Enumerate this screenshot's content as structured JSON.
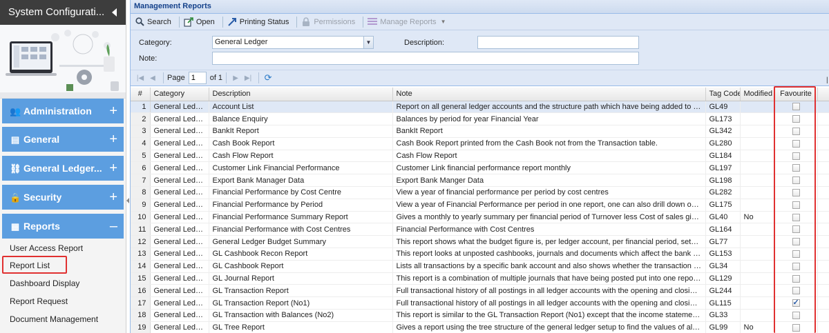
{
  "sidebar": {
    "title": "System Configurati...",
    "groups": [
      {
        "label": "Administration",
        "icon": "users-icon",
        "toggle": "+"
      },
      {
        "label": "General",
        "icon": "file-icon",
        "toggle": "+"
      },
      {
        "label": "General Ledger...",
        "icon": "link-icon",
        "toggle": "+"
      },
      {
        "label": "Security",
        "icon": "lock-icon",
        "toggle": "+"
      },
      {
        "label": "Reports",
        "icon": "report-icon",
        "toggle": "–"
      }
    ],
    "report_items": [
      "User Access Report",
      "Report List",
      "Dashboard Display",
      "Report Request",
      "Document Management"
    ]
  },
  "panel": {
    "title": "Management Reports"
  },
  "toolbar": {
    "search": "Search",
    "open": "Open",
    "printing_status": "Printing Status",
    "permissions": "Permissions",
    "manage_reports": "Manage Reports"
  },
  "filter": {
    "category_label": "Category:",
    "category_value": "General Ledger",
    "description_label": "Description:",
    "description_value": "",
    "note_label": "Note:",
    "note_value": ""
  },
  "pager": {
    "page_label": "Page",
    "page_value": "1",
    "of_label": "of 1"
  },
  "grid": {
    "columns": [
      "#",
      "Category",
      "Description",
      "Note",
      "Tag Code",
      "Modified",
      "Favourite"
    ],
    "rows": [
      {
        "n": "1",
        "category": "General Ledger",
        "description": "Account List",
        "note": "Report on all general ledger accounts and the structure path which have being added to the general led...",
        "tag": "GL49",
        "modified": "",
        "fav": false
      },
      {
        "n": "2",
        "category": "General Ledger",
        "description": "Balance Enquiry",
        "note": "Balances by period for year Financial Year",
        "tag": "GL173",
        "modified": "",
        "fav": false
      },
      {
        "n": "3",
        "category": "General Ledger",
        "description": "BankIt Report",
        "note": "BankIt Report",
        "tag": "GL342",
        "modified": "",
        "fav": false
      },
      {
        "n": "4",
        "category": "General Ledger",
        "description": "Cash Book Report",
        "note": "Cash Book Report printed from the Cash Book not from the Transaction table.",
        "tag": "GL280",
        "modified": "",
        "fav": false
      },
      {
        "n": "5",
        "category": "General Ledger",
        "description": "Cash Flow Report",
        "note": "Cash Flow Report",
        "tag": "GL184",
        "modified": "",
        "fav": false
      },
      {
        "n": "6",
        "category": "General Ledger",
        "description": "Customer Link Financial Performance",
        "note": "Customer Link financial performance report monthly",
        "tag": "GL197",
        "modified": "",
        "fav": false
      },
      {
        "n": "7",
        "category": "General Ledger",
        "description": "Export Bank Manager Data",
        "note": "Export Bank Manger Data",
        "tag": "GL198",
        "modified": "",
        "fav": false
      },
      {
        "n": "8",
        "category": "General Ledger",
        "description": "Financial Performance by Cost Centre",
        "note": "View a year of financial performance per period by cost centres",
        "tag": "GL282",
        "modified": "",
        "fav": false
      },
      {
        "n": "9",
        "category": "General Ledger",
        "description": "Financial Performance by Period",
        "note": "View a year of Financial Performance per period in one report, one can also drill down on the values to ...",
        "tag": "GL175",
        "modified": "",
        "fav": false
      },
      {
        "n": "10",
        "category": "General Ledger",
        "description": "Financial Performance Summary Report",
        "note": "Gives a monthly to yearly summary per financial period of Turnover less Cost of sales giving Gross Profi...",
        "tag": "GL40",
        "modified": "No",
        "fav": false
      },
      {
        "n": "11",
        "category": "General Ledger",
        "description": "Financial Performance with Cost Centres",
        "note": "Financial Performance with Cost Centres",
        "tag": "GL164",
        "modified": "",
        "fav": false
      },
      {
        "n": "12",
        "category": "General Ledger",
        "description": "General Ledger Budget Summary",
        "note": "This report shows what the budget figure is, per ledger account, per financial period, setup under the G...",
        "tag": "GL77",
        "modified": "",
        "fav": false
      },
      {
        "n": "13",
        "category": "General Ledger",
        "description": "GL Cashbook Recon Report",
        "note": "This report looks at unposted cashbooks, journals and documents which affect the bank and put onto a...",
        "tag": "GL153",
        "modified": "",
        "fav": false
      },
      {
        "n": "14",
        "category": "General Ledger",
        "description": "GL Cashbook Report",
        "note": "Lists all transactions by a specific bank account and also shows whether the transaction has been recon...",
        "tag": "GL34",
        "modified": "",
        "fav": false
      },
      {
        "n": "15",
        "category": "General Ledger",
        "description": "GL Journal Report",
        "note": "This report is a combination of multiple journals that have being posted put into one report with debits ...",
        "tag": "GL129",
        "modified": "",
        "fav": false
      },
      {
        "n": "16",
        "category": "General Ledger",
        "description": "GL Transaction Report",
        "note": "Full transactional history of all postings in all ledger accounts with the opening and closing balance per ...",
        "tag": "GL244",
        "modified": "",
        "fav": false
      },
      {
        "n": "17",
        "category": "General Ledger",
        "description": "GL Transaction Report (No1)",
        "note": "Full transactional history of all postings in all ledger accounts with the opening and closing balance per ...",
        "tag": "GL115",
        "modified": "",
        "fav": true
      },
      {
        "n": "18",
        "category": "General Ledger",
        "description": "GL Transaction with Balances (No2)",
        "note": "This report is similar to the GL Transaction Report (No1) except that the income statement values show...",
        "tag": "GL33",
        "modified": "",
        "fav": false
      },
      {
        "n": "19",
        "category": "General Ledger",
        "description": "GL Tree Report",
        "note": "Gives a report using the tree structure of the general ledger setup to find the values of all children acco...",
        "tag": "GL99",
        "modified": "No",
        "fav": false
      }
    ]
  },
  "colors": {
    "sidebar_group": "#5c9ee0",
    "panel_bg": "#dfe8f6",
    "highlight": "#e03030",
    "title_bar": "#3d3d3d"
  }
}
